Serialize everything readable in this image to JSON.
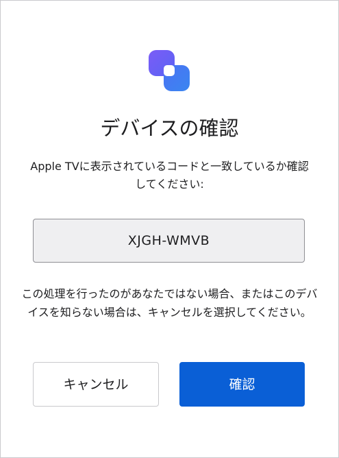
{
  "dialog": {
    "title": "デバイスの確認",
    "instruction": "Apple TVに表示されているコードと一致しているか確認してください:",
    "code": "XJGH-WMVB",
    "warning": "この処理を行ったのがあなたではない場合、またはこのデバイスを知らない場合は、キャンセルを選択してください。",
    "buttons": {
      "cancel": "キャンセル",
      "confirm": "確認"
    }
  },
  "icons": {
    "logo": "app-logo-icon"
  },
  "colors": {
    "logo_back": "#6c5cf5",
    "logo_front": "#3d7bf2",
    "primary_button": "#0a5fd6",
    "code_background": "#efeff1"
  }
}
